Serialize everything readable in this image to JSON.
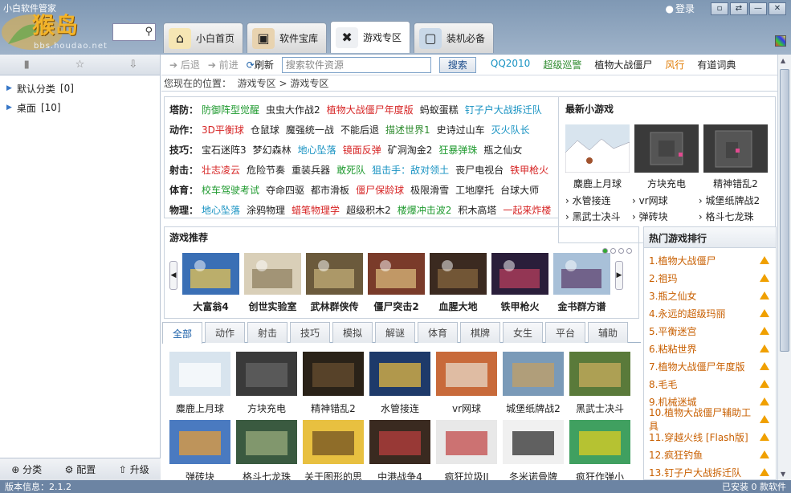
{
  "app": {
    "title": "小白软件管家",
    "brand": "猴岛",
    "brand_url": "bbs.houdao.net",
    "login": "登录"
  },
  "tabs": [
    {
      "label": "小白首页",
      "icon": "home-icon"
    },
    {
      "label": "软件宝库",
      "icon": "box-icon"
    },
    {
      "label": "游戏专区",
      "icon": "gamepad-icon"
    },
    {
      "label": "装机必备",
      "icon": "monitor-icon"
    }
  ],
  "active_tab": "游戏专区",
  "sidebar": {
    "items": [
      {
        "label": "默认分类",
        "count": "[0]"
      },
      {
        "label": "桌面",
        "count": "[10]"
      }
    ],
    "footer": {
      "category": "分类",
      "config": "配置",
      "upgrade": "升级"
    }
  },
  "navbar": {
    "back": "后退",
    "forward": "前进",
    "refresh": "刷新",
    "search_placeholder": "搜索软件资源",
    "search_button": "搜索",
    "quick_links": [
      {
        "label": "QQ2010",
        "color": "#1792c2"
      },
      {
        "label": "超级巡警",
        "color": "#2d8a2d"
      },
      {
        "label": "植物大战僵尸",
        "color": "#222222"
      },
      {
        "label": "风行",
        "color": "#e07a00"
      },
      {
        "label": "有道词典",
        "color": "#222222"
      }
    ]
  },
  "breadcrumb": {
    "prefix": "您现在的位置：",
    "path": "游戏专区 > 游戏专区"
  },
  "categories": [
    {
      "label": "塔防：",
      "games": [
        {
          "name": "防御阵型觉醒",
          "c": "green"
        },
        {
          "name": "虫虫大作战2",
          "c": ""
        },
        {
          "name": "植物大战僵尸年度版",
          "c": "red"
        },
        {
          "name": "蚂蚁蛋糕",
          "c": ""
        },
        {
          "name": "钉子户大战拆迁队",
          "c": "teal"
        }
      ]
    },
    {
      "label": "动作：",
      "games": [
        {
          "name": "3D平衡球",
          "c": "red"
        },
        {
          "name": "仓鼠球",
          "c": ""
        },
        {
          "name": "魔强统一战",
          "c": ""
        },
        {
          "name": "不能后退",
          "c": ""
        },
        {
          "name": "描述世界1",
          "c": "dkgreen"
        },
        {
          "name": "史诗过山车",
          "c": ""
        },
        {
          "name": "灭火队长",
          "c": "teal"
        }
      ]
    },
    {
      "label": "技巧：",
      "games": [
        {
          "name": "宝石迷阵3",
          "c": ""
        },
        {
          "name": "梦幻森林",
          "c": ""
        },
        {
          "name": "地心坠落",
          "c": "teal"
        },
        {
          "name": "镜面反弹",
          "c": "red"
        },
        {
          "name": "矿洞淘金2",
          "c": ""
        },
        {
          "name": "狂暴弹珠",
          "c": "green"
        },
        {
          "name": "瓶之仙女",
          "c": ""
        }
      ]
    },
    {
      "label": "射击：",
      "games": [
        {
          "name": "壮志凌云",
          "c": "red"
        },
        {
          "name": "危险节奏",
          "c": ""
        },
        {
          "name": "重装兵器",
          "c": ""
        },
        {
          "name": "敢死队",
          "c": "green"
        },
        {
          "name": "狙击手：敌对领土",
          "c": "teal"
        },
        {
          "name": "丧尸电视台",
          "c": ""
        },
        {
          "name": "铁甲枪火",
          "c": "red"
        }
      ]
    },
    {
      "label": "体育：",
      "games": [
        {
          "name": "校车驾驶考试",
          "c": "green"
        },
        {
          "name": "夺命四驱",
          "c": ""
        },
        {
          "name": "都市滑板",
          "c": ""
        },
        {
          "name": "僵尸保龄球",
          "c": "red"
        },
        {
          "name": "极限滑雪",
          "c": ""
        },
        {
          "name": "工地摩托",
          "c": ""
        },
        {
          "name": "台球大师",
          "c": ""
        }
      ]
    },
    {
      "label": "物理：",
      "games": [
        {
          "name": "地心坠落",
          "c": "teal"
        },
        {
          "name": "涂鸦物理",
          "c": ""
        },
        {
          "name": "蜡笔物理学",
          "c": "red"
        },
        {
          "name": "超级积木2",
          "c": ""
        },
        {
          "name": "楼爆冲击波2",
          "c": "green"
        },
        {
          "name": "积木高塔",
          "c": ""
        },
        {
          "name": "一起来炸楼",
          "c": "red"
        }
      ]
    }
  ],
  "new_games": {
    "title": "最新小游戏",
    "thumbs": [
      {
        "name": "麋鹿上月球",
        "icon": "snow-scene"
      },
      {
        "name": "方块充电",
        "icon": "dark-maze"
      },
      {
        "name": "精神错乱2",
        "icon": "dark-maze"
      }
    ],
    "links": [
      "水管接连",
      "vr网球",
      "城堡纸牌战2",
      "黑武士决斗",
      "弹砖块",
      "格斗七龙珠"
    ]
  },
  "recommend": {
    "title": "游戏推荐",
    "items": [
      "大富翁4",
      "创世实验室",
      "武林群侠传",
      "僵尸突击2",
      "血腥大地",
      "铁甲枪火",
      "金书群方谱"
    ]
  },
  "hot": {
    "title": "热门游戏排行",
    "items": [
      {
        "label": "1.植物大战僵尸",
        "top": true
      },
      {
        "label": "2.祖玛",
        "top": true
      },
      {
        "label": "3.瓶之仙女",
        "top": true
      },
      {
        "label": "4.永远的超级玛丽",
        "top": false
      },
      {
        "label": "5.平衡迷宫",
        "top": false
      },
      {
        "label": "6.粘粘世界",
        "top": false
      },
      {
        "label": "7.植物大战僵尸年度版",
        "top": false
      },
      {
        "label": "8.毛毛",
        "top": false
      },
      {
        "label": "9.机械迷城",
        "top": false
      },
      {
        "label": "10.植物大战僵尸辅助工具",
        "top": false
      },
      {
        "label": "11.穿越火线 [Flash版]",
        "top": false
      },
      {
        "label": "12.疯狂钓鱼",
        "top": false
      },
      {
        "label": "13.钉子户大战拆迁队",
        "top": false
      }
    ]
  },
  "category_tabs": [
    "全部",
    "动作",
    "射击",
    "技巧",
    "模拟",
    "解谜",
    "体育",
    "棋牌",
    "女生",
    "平台",
    "辅助"
  ],
  "grid": {
    "row1": [
      "麋鹿上月球",
      "方块充电",
      "精神错乱2",
      "水管接连",
      "vr网球",
      "城堡纸牌战2",
      "黑武士决斗"
    ],
    "row2": [
      "弹砖块",
      "格斗七龙珠",
      "关于图形的思",
      "中港战争4",
      "疯狂垃圾II",
      "冬米诺骨牌",
      "疯狂作弹小"
    ]
  },
  "status": {
    "version": "版本信息：2.1.2",
    "installed": "已安装  0  款软件"
  }
}
